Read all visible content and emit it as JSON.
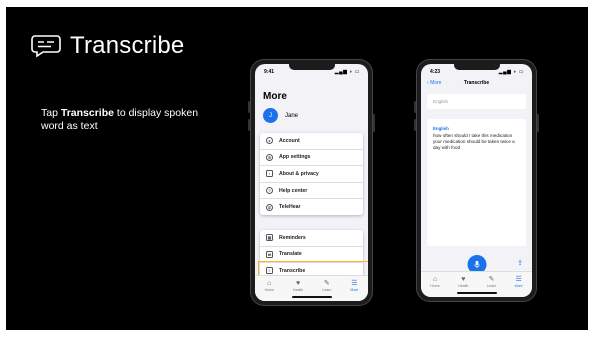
{
  "slide": {
    "title": "Transcribe",
    "description_pre": "Tap ",
    "description_bold": "Transcribe",
    "description_post": " to display spoken word  as text"
  },
  "phone1": {
    "time": "9:41",
    "heading": "More",
    "avatar_initial": "J",
    "user_name": "Jane",
    "card1_items": [
      "Account",
      "App settings",
      "About & privacy",
      "Help center",
      "TeleHear"
    ],
    "card2_items": [
      "Reminders",
      "Translate",
      "Transcribe"
    ],
    "highlighted_item": "Transcribe",
    "tabs": [
      "Home",
      "Health",
      "Learn",
      "More"
    ],
    "active_tab": "More"
  },
  "phone2": {
    "time": "4:23",
    "back_label": "More",
    "nav_title": "Transcribe",
    "language_field": "English",
    "transcript_label": "English",
    "transcript_text": "how often should I take this medication your medication should be taken twice a day with food",
    "tabs": [
      "Home",
      "Health",
      "Learn",
      "More"
    ],
    "active_tab": "More"
  },
  "colors": {
    "accent": "#1a73e8",
    "highlight": "#f2b82c",
    "slide_bg": "#000000"
  }
}
